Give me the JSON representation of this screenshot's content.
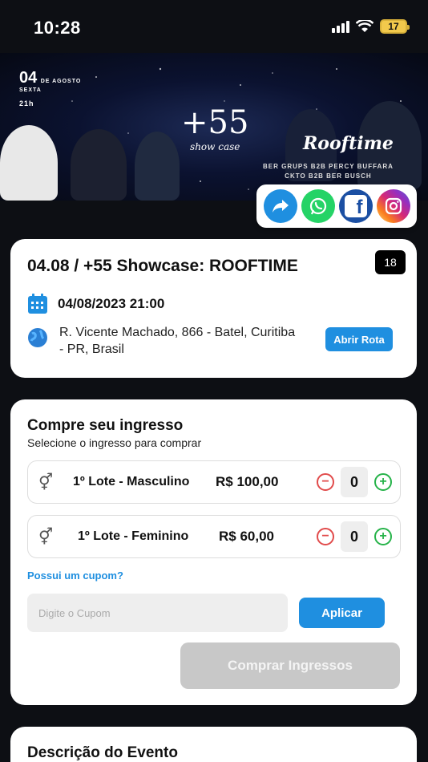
{
  "status_bar": {
    "time": "10:28",
    "battery": "17",
    "battery_color": "#f2c94c"
  },
  "banner": {
    "date_day": "04",
    "date_month": "DE AGOSTO",
    "date_weekday": "SEXTA",
    "time": "21h",
    "logo_number": "+55",
    "logo_sub": "show case",
    "title": "Rooftime",
    "credits_line1": "BER GRUPS B2B PERCY BUFFARA",
    "credits_line2": "CKTO B2B BER BUSCH"
  },
  "share": {
    "items": [
      {
        "name": "share-icon",
        "color": "#1f8fe0"
      },
      {
        "name": "whatsapp-icon",
        "color": "#25d366"
      },
      {
        "name": "facebook-icon",
        "color": "#1877f2"
      },
      {
        "name": "instagram-icon",
        "color": "#d62976"
      }
    ]
  },
  "event": {
    "title": "04.08 / +55 Showcase: ROOFTIME",
    "age_rating": "18",
    "datetime": "04/08/2023 21:00",
    "address": "R. Vicente Machado, 866 - Batel, Curitiba - PR, Brasil",
    "route_label": "Abrir Rota"
  },
  "tickets": {
    "heading": "Compre seu ingresso",
    "subheading": "Selecione o ingresso para comprar",
    "items": [
      {
        "label": "1º Lote - Masculino",
        "price": "R$ 100,00",
        "qty": "0"
      },
      {
        "label": "1º Lote - Feminino",
        "price": "R$ 60,00",
        "qty": "0"
      }
    ],
    "coupon_link": "Possui um cupom?",
    "coupon_placeholder": "Digite o Cupom",
    "apply_label": "Aplicar",
    "buy_label": "Comprar Ingressos"
  },
  "description": {
    "heading": "Descrição do Evento"
  },
  "colors": {
    "accent": "#1f8fe0",
    "minus": "#e14b4b",
    "plus": "#27b34a",
    "disabled": "#c8c8c8"
  }
}
